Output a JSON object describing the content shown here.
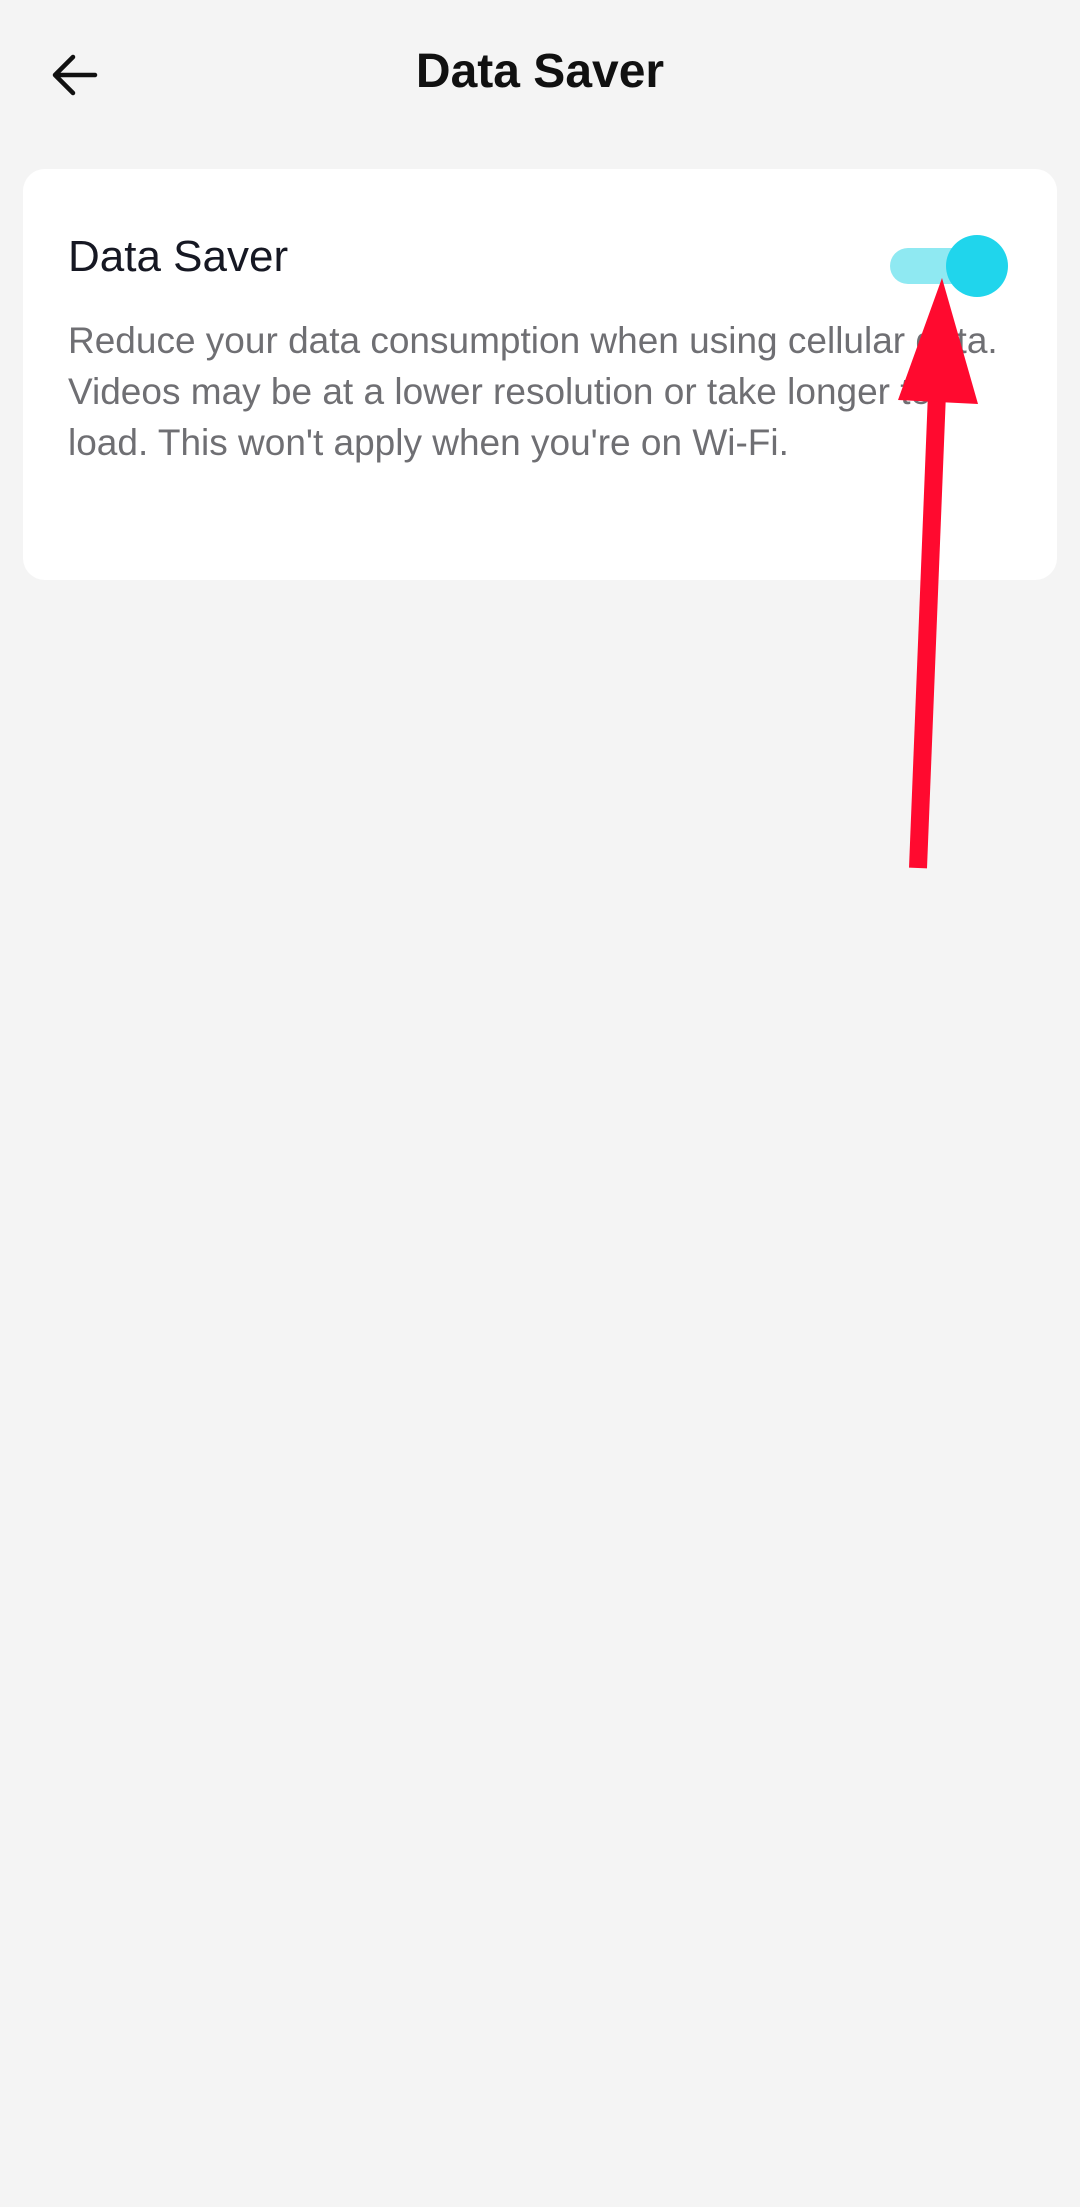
{
  "header": {
    "title": "Data Saver",
    "back_icon": "arrow-left-icon"
  },
  "setting": {
    "title": "Data Saver",
    "description": "Reduce your data consumption when using cellular data. Videos may be at a lower resolution or take longer to load. This won't apply when you're on Wi-Fi.",
    "toggle_state": "on"
  },
  "colors": {
    "background": "#f4f4f4",
    "card": "#ffffff",
    "toggle_track": "#8fe9f2",
    "toggle_knob": "#20d5ec",
    "annotation_arrow": "#ff0a2f"
  }
}
